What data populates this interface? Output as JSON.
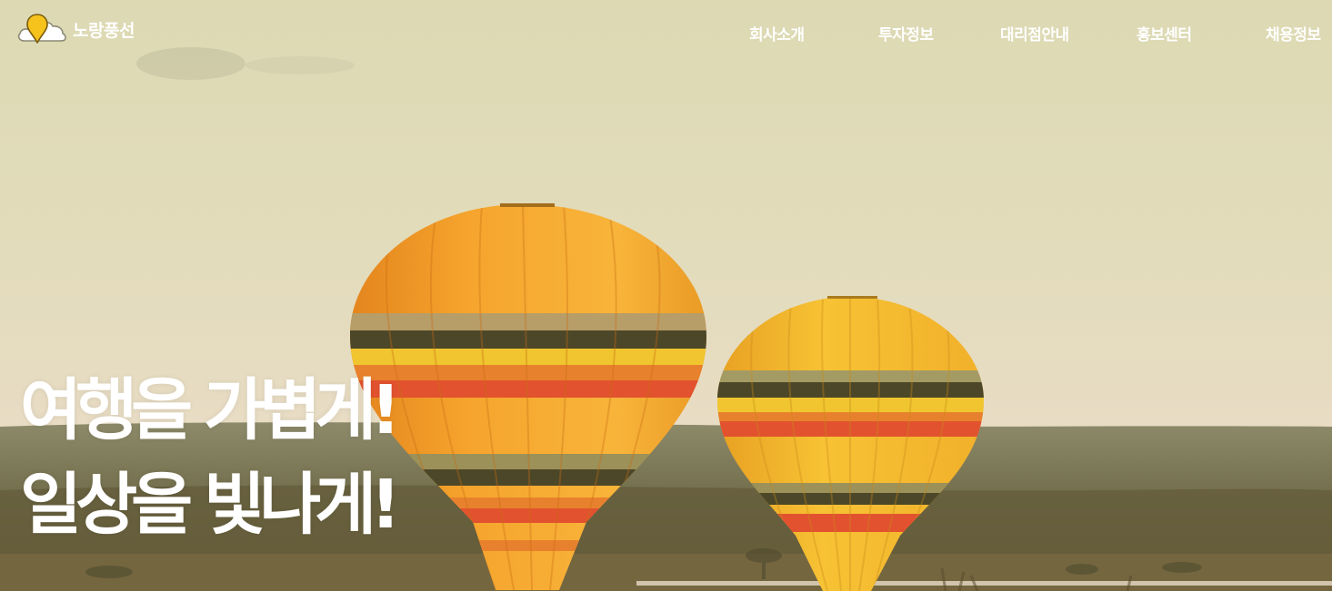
{
  "brand": {
    "logo_icon": "balloon-cloud-icon",
    "name": "노랑풍선",
    "accent_color": "#f6c21c"
  },
  "nav": {
    "items": [
      {
        "label": "회사소개"
      },
      {
        "label": "투자정보"
      },
      {
        "label": "대리점안내"
      },
      {
        "label": "홍보센터"
      },
      {
        "label": "채용정보"
      }
    ]
  },
  "hero": {
    "headline_line1": "여행을 가볍게!",
    "headline_line2": "일상을 빛나게!",
    "background": "hot-air-balloons-savanna-photo",
    "balloon_colors": [
      "#f7a22a",
      "#f4c630",
      "#e8522a",
      "#4f4a2e"
    ]
  }
}
